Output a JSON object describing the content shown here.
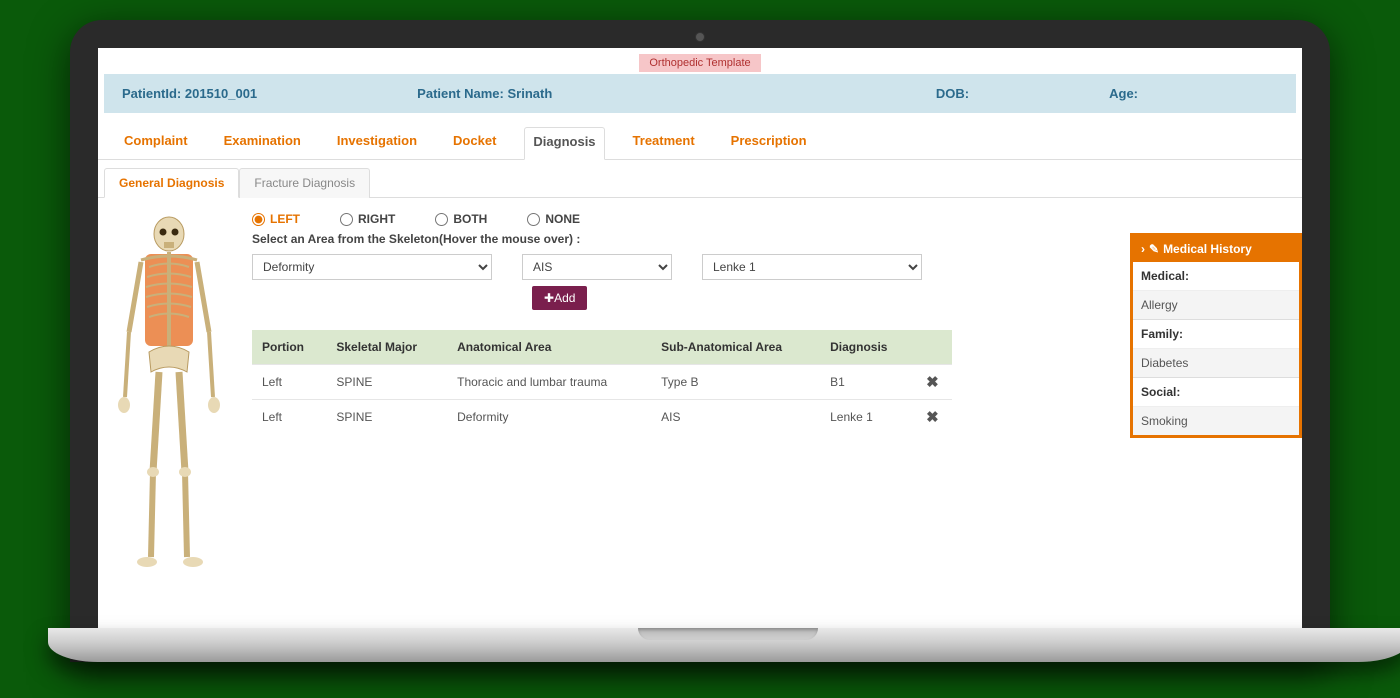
{
  "template_badge": "Orthopedic Template",
  "patient": {
    "id_label": "PatientId:",
    "id_value": "201510_001",
    "name_label": "Patient Name:",
    "name_value": "Srinath",
    "dob_label": "DOB:",
    "dob_value": "",
    "age_label": "Age:",
    "age_value": ""
  },
  "tabs_main": [
    "Complaint",
    "Examination",
    "Investigation",
    "Docket",
    "Diagnosis",
    "Treatment",
    "Prescription"
  ],
  "tabs_main_active": "Diagnosis",
  "tabs_sub": [
    "General Diagnosis",
    "Fracture Diagnosis"
  ],
  "tabs_sub_active": "General Diagnosis",
  "side_options": [
    "LEFT",
    "RIGHT",
    "BOTH",
    "NONE"
  ],
  "side_selected": "LEFT",
  "instruction": "Select an Area from the Skeleton(Hover the mouse over) :",
  "selects": {
    "sel1": "Deformity",
    "sel2": "AIS",
    "sel3": "Lenke 1"
  },
  "add_button": "Add",
  "table": {
    "headers": [
      "Portion",
      "Skeletal Major",
      "Anatomical Area",
      "Sub-Anatomical Area",
      "Diagnosis",
      ""
    ],
    "rows": [
      {
        "portion": "Left",
        "major": "SPINE",
        "area": "Thoracic and lumbar trauma",
        "subarea": "Type B",
        "diagnosis": "B1"
      },
      {
        "portion": "Left",
        "major": "SPINE",
        "area": "Deformity",
        "subarea": "AIS",
        "diagnosis": "Lenke 1"
      }
    ]
  },
  "medical_history": {
    "title": "Medical History",
    "sections": [
      {
        "label": "Medical:",
        "value": "Allergy"
      },
      {
        "label": "Family:",
        "value": "Diabetes"
      },
      {
        "label": "Social:",
        "value": "Smoking"
      }
    ]
  }
}
